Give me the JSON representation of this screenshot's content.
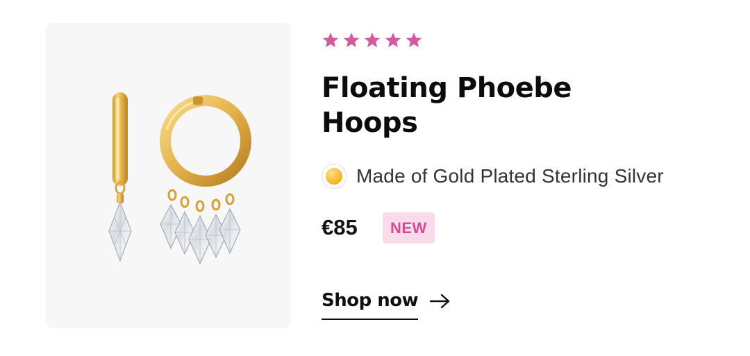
{
  "product": {
    "image_alt": "Floating Phoebe Hoops earrings",
    "rating": {
      "stars": 5,
      "max": 5,
      "color": "#d45aa0"
    },
    "title": "Floating Phoebe Hoops",
    "material": {
      "label": "Made of Gold Plated Sterling Silver",
      "swatch_color": "#f6bd33",
      "swatch_icon": "gold-swatch-icon"
    },
    "price": "€85",
    "badge": "NEW",
    "cta": {
      "label": "Shop now",
      "icon": "arrow-right-icon"
    }
  },
  "colors": {
    "accent": "#d45aa0",
    "badge_bg": "#f8dcea",
    "text": "#111111",
    "panel_bg": "#f7f7f7"
  }
}
